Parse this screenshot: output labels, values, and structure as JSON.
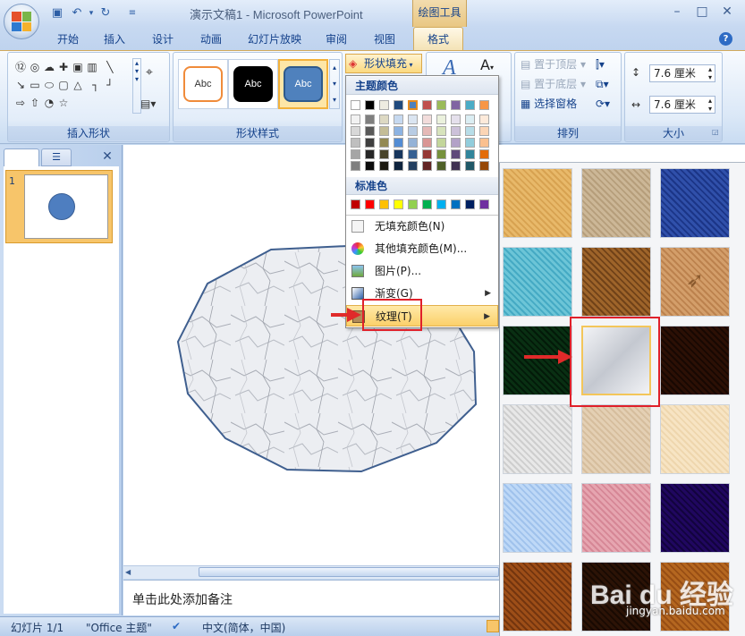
{
  "window": {
    "title": "演示文稿1 - Microsoft PowerPoint",
    "context_tab_label": "绘图工具",
    "minimize": "–",
    "restore": "□",
    "close": "✕"
  },
  "tabs": [
    "开始",
    "插入",
    "设计",
    "动画",
    "幻灯片放映",
    "审阅",
    "视图"
  ],
  "active_tab": "格式",
  "ribbon": {
    "insert_shapes_label": "插入形状",
    "shape_styles_label": "形状样式",
    "arrange_label": "排列",
    "size_label": "大小",
    "style_sample_text": "Abc",
    "shape_fill_button": "形状填充",
    "bring_to_front": "置于顶层",
    "send_to_back": "置于底层",
    "selection_pane": "选择窗格",
    "height_value": "7.6 厘米",
    "width_value": "7.6 厘米"
  },
  "left_panel": {
    "slide_number": "1"
  },
  "notes_placeholder": "单击此处添加备注",
  "status": {
    "slide_info": "幻灯片 1/1",
    "theme": "\"Office 主题\"",
    "language": "中文(简体，中国)"
  },
  "menu": {
    "theme_colors_header": "主题颜色",
    "standard_colors_header": "标准色",
    "no_fill": "无填充颜色(N)",
    "more_colors": "其他填充颜色(M)...",
    "picture": "图片(P)...",
    "gradient": "渐变(G)",
    "texture": "纹理(T)",
    "theme_colors_top": [
      "#ffffff",
      "#000000",
      "#eeece1",
      "#1f497d",
      "#4f81bd",
      "#c0504d",
      "#9bbb59",
      "#8064a2",
      "#4bacc6",
      "#f79646"
    ],
    "theme_colors_shades": [
      [
        "#f2f2f2",
        "#7f7f7f",
        "#ddd9c3",
        "#c6d9f0",
        "#dbe5f1",
        "#f2dcdb",
        "#ebf1dd",
        "#e5e0ec",
        "#dbeef3",
        "#fdeada"
      ],
      [
        "#d8d8d8",
        "#595959",
        "#c4bd97",
        "#8db3e2",
        "#b8cce4",
        "#e5b9b7",
        "#d7e3bc",
        "#ccc1d9",
        "#b7dde8",
        "#fbd5b5"
      ],
      [
        "#bfbfbf",
        "#3f3f3f",
        "#938953",
        "#548dd4",
        "#95b3d7",
        "#d99694",
        "#c3d69b",
        "#b2a2c7",
        "#92cddc",
        "#fac08f"
      ],
      [
        "#a5a5a5",
        "#262626",
        "#494429",
        "#17365d",
        "#366092",
        "#953734",
        "#76923c",
        "#5f497a",
        "#31859b",
        "#e36c09"
      ],
      [
        "#7f7f7f",
        "#0c0c0c",
        "#1d1b10",
        "#0f243e",
        "#244061",
        "#632423",
        "#4f6128",
        "#3f3151",
        "#205867",
        "#974806"
      ]
    ],
    "standard_colors": [
      "#c00000",
      "#ff0000",
      "#ffc000",
      "#ffff00",
      "#92d050",
      "#00b050",
      "#00b0f0",
      "#0070c0",
      "#002060",
      "#7030a0"
    ]
  },
  "textures": [
    {
      "name": "papyrus",
      "c1": "#f3d9a4",
      "c2": "#e2bf7e"
    },
    {
      "name": "canvas",
      "c1": "#e4d8c4",
      "c2": "#cbbba0"
    },
    {
      "name": "denim",
      "c1": "#6f8fd0",
      "c2": "#3f5fa6"
    },
    {
      "name": "water-droplets",
      "c1": "#a6e0ea",
      "c2": "#6ac2d6"
    },
    {
      "name": "paper-bag",
      "c1": "#c9a068",
      "c2": "#8f6a3c"
    },
    {
      "name": "fish-fossil",
      "c1": "#e8c9a4",
      "c2": "#cfa579"
    },
    {
      "name": "green-marble",
      "c1": "#2f6f45",
      "c2": "#123c22"
    },
    {
      "name": "white-marble",
      "c1": "#f2f3f6",
      "c2": "#c4c8d0"
    },
    {
      "name": "brown-marble",
      "c1": "#6a3f22",
      "c2": "#3a1f0f"
    },
    {
      "name": "granite",
      "c1": "#f3f3f3",
      "c2": "#d8d8d8"
    },
    {
      "name": "newsprint",
      "c1": "#f1e6d6",
      "c2": "#e2d2bb"
    },
    {
      "name": "recycled-paper",
      "c1": "#fbf1df",
      "c2": "#f2e2c6"
    },
    {
      "name": "blue-tissue",
      "c1": "#dcebfb",
      "c2": "#b9d3f0"
    },
    {
      "name": "pink-tissue",
      "c1": "#f2cdd4",
      "c2": "#e2a8b4"
    },
    {
      "name": "purple-mesh",
      "c1": "#5b2a9c",
      "c2": "#331166"
    },
    {
      "name": "cork",
      "c1": "#c88d4f",
      "c2": "#94602c"
    },
    {
      "name": "walnut",
      "c1": "#6a4526",
      "c2": "#3c2410"
    },
    {
      "name": "oak",
      "c1": "#d7a25a",
      "c2": "#b47a38"
    }
  ],
  "watermark": {
    "main": "Bai du 经验",
    "sub": "jingyan.baidu.com"
  }
}
